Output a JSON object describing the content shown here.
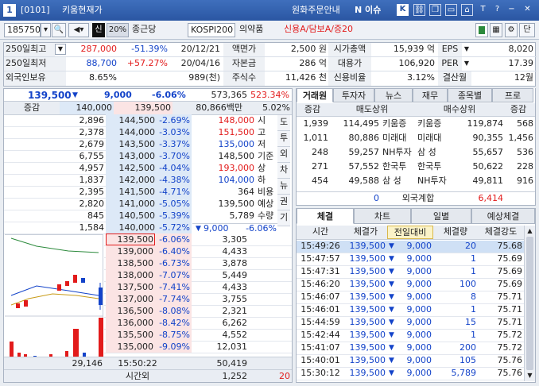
{
  "window": {
    "id": "1",
    "code": "[0101]",
    "title": "키움현재가",
    "links": [
      "원화주문안내",
      "N 이슈"
    ]
  },
  "toolbar": {
    "code": "185750",
    "sin": "신",
    "margin": "20%",
    "name": "종근당",
    "market": "KOSPI200",
    "sector": "의약품",
    "credit": "신용A/담보A/증20",
    "single": "단"
  },
  "info": {
    "row1": {
      "label": "250일최고",
      "price": "287,000",
      "pct": "-51.39%",
      "date": "20/12/21",
      "k1": "액면가",
      "v1": "2,500 원",
      "k2": "시가총액",
      "v2": "15,939 억",
      "k3": "EPS",
      "v3": "8,020"
    },
    "row2": {
      "label": "250일최저",
      "price": "88,700",
      "pct": "+57.27%",
      "date": "20/04/16",
      "k1": "자본금",
      "v1": "286 억",
      "k2": "대용가",
      "v2": "106,920",
      "k3": "PER",
      "v3": "17.39"
    },
    "row3": {
      "label": "외국인보유",
      "pct": "8.65%",
      "qty": "989(천)",
      "k1": "주식수",
      "v1": "11,426 천",
      "k2": "신용비율",
      "v2": "3.12%",
      "k3": "결산월",
      "v3": "12월"
    }
  },
  "quote": {
    "price": "139,500",
    "change": "9,000",
    "pct": "-6.06%",
    "volume": "573,365",
    "vol_pct": "523.34%",
    "inc_label": "증감",
    "inc_sell": "140,000",
    "inc_buy": "139,500",
    "amount": "80,866백만",
    "ratio": "5.02%"
  },
  "asks": [
    {
      "qty": "2,896",
      "price": "144,500",
      "pct": "-2.69%"
    },
    {
      "qty": "2,378",
      "price": "144,000",
      "pct": "-3.03%"
    },
    {
      "qty": "2,679",
      "price": "143,500",
      "pct": "-3.37%"
    },
    {
      "qty": "6,755",
      "price": "143,000",
      "pct": "-3.70%"
    },
    {
      "qty": "4,957",
      "price": "142,500",
      "pct": "-4.04%"
    },
    {
      "qty": "1,837",
      "price": "142,000",
      "pct": "-4.38%"
    },
    {
      "qty": "2,395",
      "price": "141,500",
      "pct": "-4.71%"
    },
    {
      "qty": "2,820",
      "price": "141,000",
      "pct": "-5.05%"
    },
    {
      "qty": "845",
      "price": "140,500",
      "pct": "-5.39%"
    },
    {
      "qty": "1,584",
      "price": "140,000",
      "pct": "-5.72%"
    }
  ],
  "bids": [
    {
      "price": "139,500",
      "pct": "-6.06%",
      "qty": "3,305"
    },
    {
      "price": "139,000",
      "pct": "-6.40%",
      "qty": "4,433"
    },
    {
      "price": "138,500",
      "pct": "-6.73%",
      "qty": "3,878"
    },
    {
      "price": "138,000",
      "pct": "-7.07%",
      "qty": "5,449"
    },
    {
      "price": "137,500",
      "pct": "-7.41%",
      "qty": "4,433"
    },
    {
      "price": "137,000",
      "pct": "-7.74%",
      "qty": "3,755"
    },
    {
      "price": "136,500",
      "pct": "-8.08%",
      "qty": "2,321"
    },
    {
      "price": "136,000",
      "pct": "-8.42%",
      "qty": "6,262"
    },
    {
      "price": "135,500",
      "pct": "-8.75%",
      "qty": "4,552"
    },
    {
      "price": "135,000",
      "pct": "-9.09%",
      "qty": "12,031"
    }
  ],
  "summary": [
    {
      "v": "148,000",
      "k": "시"
    },
    {
      "v": "151,500",
      "k": "고"
    },
    {
      "v": "135,000",
      "k": "저"
    },
    {
      "v": "148,500",
      "k": "기준"
    },
    {
      "v": "193,000",
      "k": "상"
    },
    {
      "v": "104,000",
      "k": "하"
    },
    {
      "v": "364",
      "k": "비용"
    },
    {
      "v": "139,500",
      "k": "예상"
    },
    {
      "v": "5,789",
      "k": "수량"
    }
  ],
  "expected": {
    "change": "9,000",
    "pct": "-6.06%"
  },
  "side_tabs": [
    "도",
    "투",
    "외",
    "차",
    "뉴",
    "권",
    "기"
  ],
  "bottom": {
    "ask_total": "29,146",
    "time": "15:50:22",
    "bid_total": "50,419",
    "after_label": "시간외",
    "after_qty": "1,252",
    "after_val": "20"
  },
  "broker": {
    "tabs": [
      "거래원",
      "투자자",
      "뉴스",
      "재무",
      "종목별",
      "프로"
    ],
    "headers": [
      "증감",
      "매도상위",
      "매수상위",
      "증감"
    ],
    "rows": [
      {
        "sv": "1,939",
        "sq": "114,495",
        "sn": "키움증",
        "bn": "키움증",
        "bq": "119,874",
        "bv": "568"
      },
      {
        "sv": "1,011",
        "sq": "80,886",
        "sn": "미래대",
        "bn": "미래대",
        "bq": "90,355",
        "bv": "1,456"
      },
      {
        "sv": "248",
        "sq": "59,257",
        "sn": "NH투자",
        "bn": "삼  성",
        "bq": "55,657",
        "bv": "536"
      },
      {
        "sv": "271",
        "sq": "57,552",
        "sn": "한국투",
        "bn": "한국투",
        "bq": "50,622",
        "bv": "228"
      },
      {
        "sv": "454",
        "sq": "49,588",
        "sn": "삼  성",
        "bn": "NH투자",
        "bq": "49,811",
        "bv": "916"
      }
    ],
    "foreign": {
      "sell": "0",
      "label": "외국계합",
      "buy": "6,414"
    }
  },
  "trades": {
    "tabs": [
      "체결",
      "차트",
      "일별",
      "예상체결"
    ],
    "headers": [
      "시간",
      "체결가",
      "전일대비",
      "체결량",
      "체결강도"
    ],
    "rows": [
      {
        "time": "15:49:26",
        "price": "139,500",
        "change": "9,000",
        "qty": "20",
        "strength": "75.68"
      },
      {
        "time": "15:47:57",
        "price": "139,500",
        "change": "9,000",
        "qty": "1",
        "strength": "75.69"
      },
      {
        "time": "15:47:31",
        "price": "139,500",
        "change": "9,000",
        "qty": "1",
        "strength": "75.69"
      },
      {
        "time": "15:46:20",
        "price": "139,500",
        "change": "9,000",
        "qty": "100",
        "strength": "75.69"
      },
      {
        "time": "15:46:07",
        "price": "139,500",
        "change": "9,000",
        "qty": "8",
        "strength": "75.71"
      },
      {
        "time": "15:46:01",
        "price": "139,500",
        "change": "9,000",
        "qty": "1",
        "strength": "75.71"
      },
      {
        "time": "15:44:59",
        "price": "139,500",
        "change": "9,000",
        "qty": "15",
        "strength": "75.71"
      },
      {
        "time": "15:42:44",
        "price": "139,500",
        "change": "9,000",
        "qty": "1",
        "strength": "75.72"
      },
      {
        "time": "15:41:07",
        "price": "139,500",
        "change": "9,000",
        "qty": "200",
        "strength": "75.72"
      },
      {
        "time": "15:40:01",
        "price": "139,500",
        "change": "9,000",
        "qty": "105",
        "strength": "75.76"
      },
      {
        "time": "15:30:12",
        "price": "139,500",
        "change": "9,000",
        "qty": "5,789",
        "strength": "75.76"
      }
    ]
  },
  "colors": {
    "up": "#e21b1b",
    "down": "#1343c9",
    "ask_bg": "#dde9f7",
    "bid_bg": "#fbe4e4",
    "title_bar": "#2f5ea8"
  }
}
